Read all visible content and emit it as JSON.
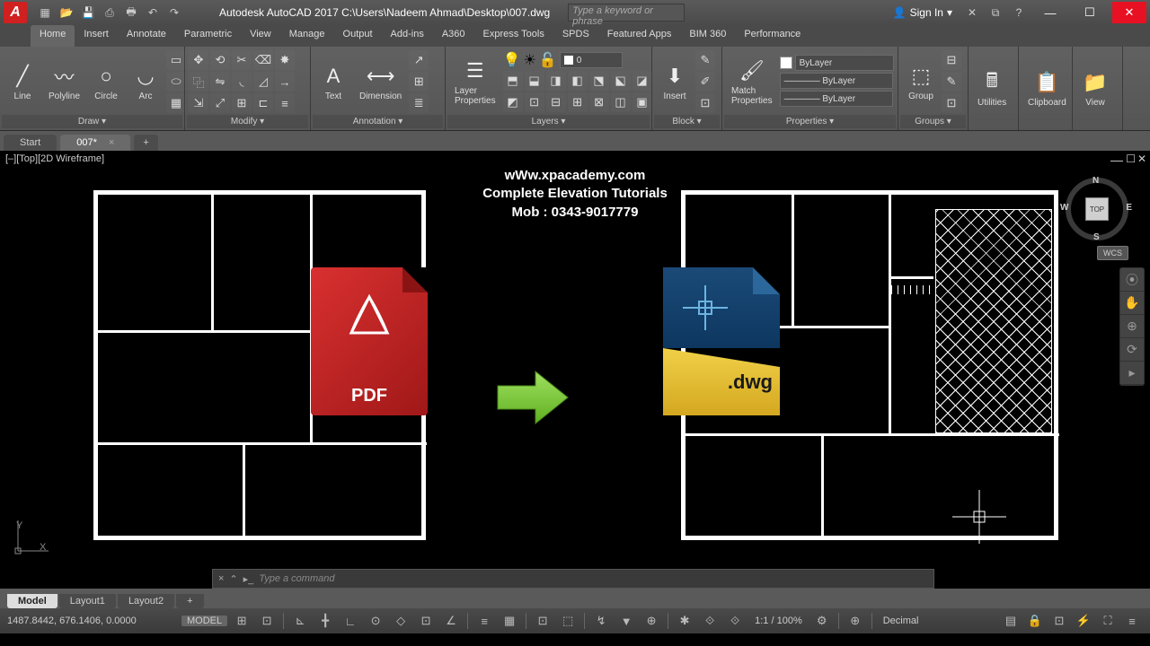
{
  "app": {
    "logo": "A",
    "title": "Autodesk AutoCAD 2017   C:\\Users\\Nadeem Ahmad\\Desktop\\007.dwg",
    "keyword_placeholder": "Type a keyword or phrase",
    "signin": "Sign In"
  },
  "menu": [
    "Home",
    "Insert",
    "Annotate",
    "Parametric",
    "View",
    "Manage",
    "Output",
    "Add-ins",
    "A360",
    "Express Tools",
    "SPDS",
    "Featured Apps",
    "BIM 360",
    "Performance"
  ],
  "ribbon": {
    "draw": {
      "title": "Draw ▾",
      "line": "Line",
      "polyline": "Polyline",
      "circle": "Circle",
      "arc": "Arc"
    },
    "modify": {
      "title": "Modify ▾"
    },
    "annotation": {
      "title": "Annotation ▾",
      "text": "Text",
      "dim": "Dimension"
    },
    "layers": {
      "title": "Layers ▾",
      "props": "Layer\nProperties",
      "current": "0"
    },
    "block": {
      "title": "Block ▾",
      "insert": "Insert"
    },
    "props": {
      "title": "Properties ▾",
      "match": "Match\nProperties",
      "color": "ByLayer",
      "lw": "———— ByLayer",
      "lt": "———— ByLayer"
    },
    "groups": {
      "title": "Groups ▾",
      "group": "Group"
    },
    "util": "Utilities",
    "clip": "Clipboard",
    "view": "View"
  },
  "fileTabs": {
    "start": "Start",
    "doc": "007*",
    "add": "+"
  },
  "viewport": {
    "label": "[–][Top][2D Wireframe]"
  },
  "overlay": {
    "l1": "wWw.xpacademy.com",
    "l2": "Complete Elevation Tutorials",
    "l3": "Mob : 0343-9017779"
  },
  "pdf": {
    "label": "PDF"
  },
  "dwg": {
    "label": ".dwg"
  },
  "cmd": {
    "placeholder": "Type a command"
  },
  "navcube": {
    "top": "TOP",
    "n": "N",
    "s": "S",
    "e": "E",
    "w": "W",
    "wcs": "WCS"
  },
  "ucs": {
    "x": "X",
    "y": "Y"
  },
  "layouts": {
    "model": "Model",
    "l1": "Layout1",
    "l2": "Layout2",
    "add": "+"
  },
  "status": {
    "coords": "1487.8442, 676.1406, 0.0000",
    "model": "MODEL",
    "scale": "1:1 / 100%",
    "units": "Decimal"
  }
}
